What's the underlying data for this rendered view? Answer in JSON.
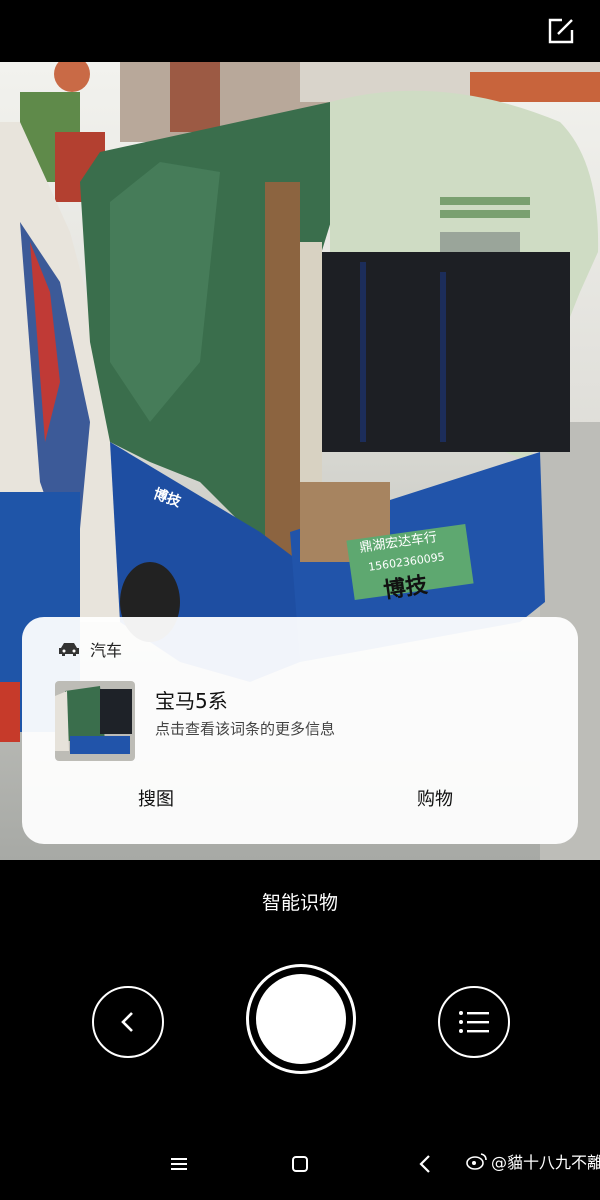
{
  "result_card": {
    "category_icon": "car-icon",
    "category_label": "汽车",
    "title": "宝马5系",
    "subtitle": "点击查看该词条的更多信息",
    "actions": {
      "search": "搜图",
      "shop": "购物"
    }
  },
  "camera": {
    "mode_label": "智能识物"
  },
  "photo_text": {
    "sign_line1": "鼎湖宏达车行",
    "sign_line2": "15602360095",
    "sign_line3": "博技",
    "side_text": "博技"
  },
  "watermark": {
    "icon": "weibo-icon",
    "text": "@貓十八九不離十"
  },
  "colors": {
    "card_bg": "#ffffff",
    "background": "#000000",
    "text_primary": "#111111"
  }
}
